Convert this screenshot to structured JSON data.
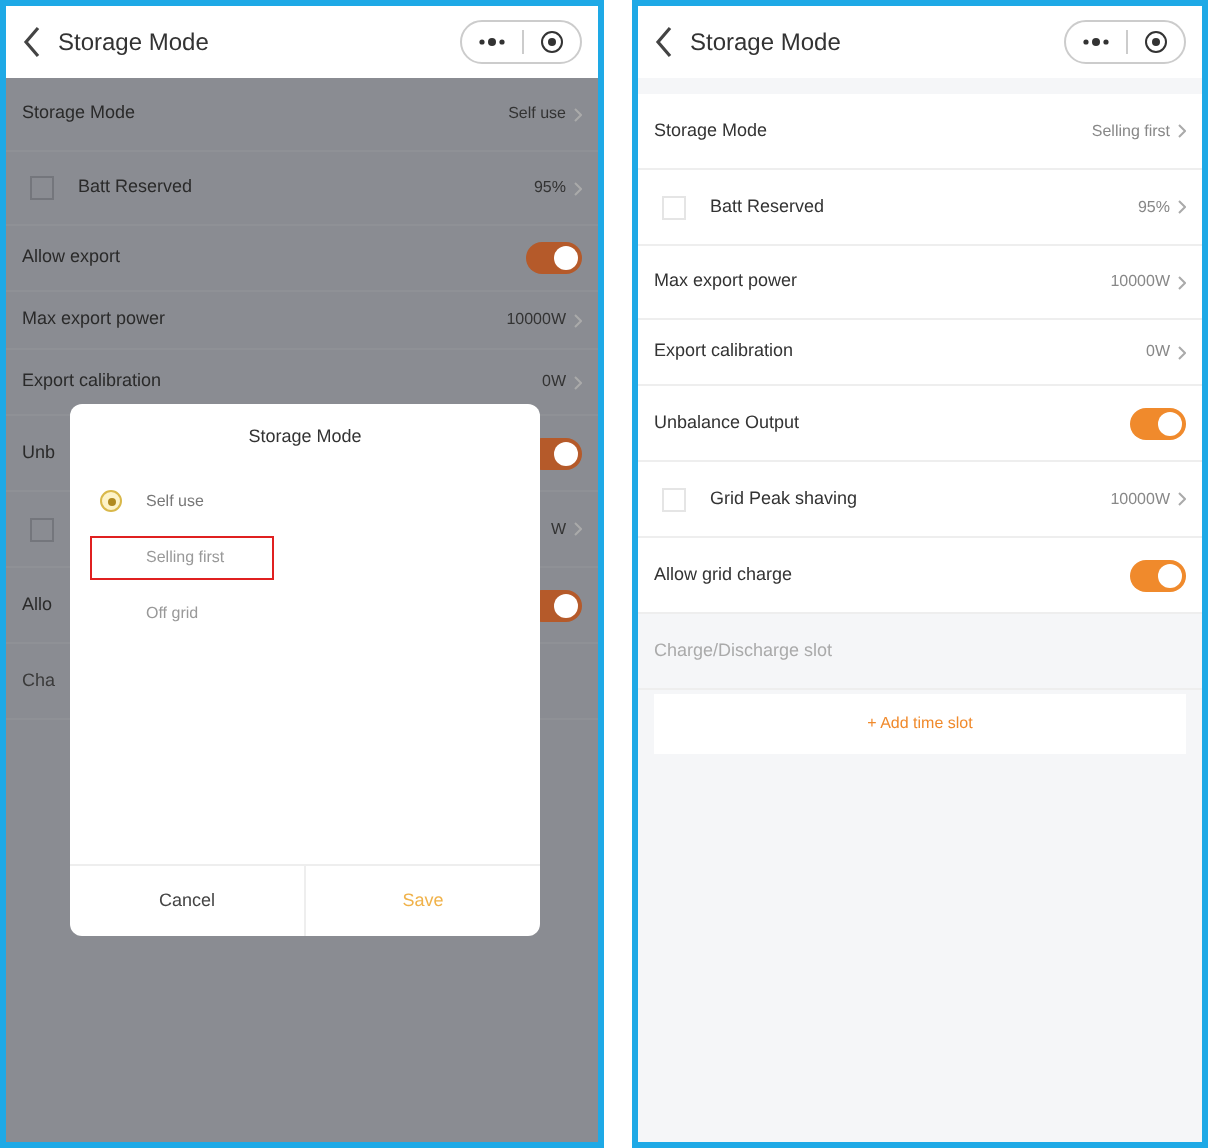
{
  "left": {
    "header": {
      "title": "Storage Mode"
    },
    "rows": [
      {
        "kind": "value",
        "label": "Storage Mode",
        "value": "Self use",
        "indent": false
      },
      {
        "kind": "value",
        "label": "Batt Reserved",
        "value": "95%",
        "indent": true
      },
      {
        "kind": "toggle",
        "label": "Allow export",
        "on": true,
        "indent": false
      },
      {
        "kind": "value",
        "label": "Max export power",
        "value": "10000W",
        "indent": false
      },
      {
        "kind": "value",
        "label": "Export calibration",
        "value": "0W",
        "indent": false
      },
      {
        "kind": "toggle",
        "label": "Unb",
        "on": true,
        "indent": false
      },
      {
        "kind": "value",
        "label": "",
        "value": "W",
        "indent": true
      },
      {
        "kind": "toggle",
        "label": "Allo",
        "on": true,
        "indent": false
      },
      {
        "kind": "label",
        "label": "Cha",
        "indent": false
      }
    ],
    "dialog": {
      "title": "Storage Mode",
      "options": [
        {
          "label": "Self use",
          "selected": true,
          "highlighted": false
        },
        {
          "label": "Selling first",
          "selected": false,
          "highlighted": true
        },
        {
          "label": "Off grid",
          "selected": false,
          "highlighted": false
        }
      ],
      "buttons": [
        {
          "label": "Cancel",
          "kind": "cancel"
        },
        {
          "label": "Save",
          "kind": "confirm"
        }
      ]
    }
  },
  "right": {
    "header": {
      "title": "Storage Mode"
    },
    "rows": [
      {
        "kind": "value",
        "label": "Storage Mode",
        "value": "Selling first",
        "indent": false
      },
      {
        "kind": "value",
        "label": "Batt Reserved",
        "value": "95%",
        "indent": true
      },
      {
        "kind": "value",
        "label": "Max export power",
        "value": "10000W",
        "indent": false
      },
      {
        "kind": "value",
        "label": "Export calibration",
        "value": "0W",
        "indent": false
      },
      {
        "kind": "toggle",
        "label": "Unbalance Output",
        "on": true,
        "indent": false
      },
      {
        "kind": "value",
        "label": "Grid Peak shaving",
        "value": "10000W",
        "indent": true
      },
      {
        "kind": "toggle",
        "label": "Allow grid charge",
        "on": true,
        "indent": false
      },
      {
        "kind": "label",
        "label": "Charge/Discharge slot",
        "indent": false
      }
    ],
    "add_button": "+ Add time slot"
  }
}
